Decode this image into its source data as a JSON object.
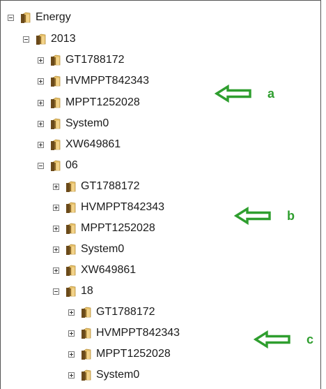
{
  "tree": {
    "root": {
      "label": "Energy",
      "state": "expanded"
    },
    "year": {
      "label": "2013",
      "state": "expanded"
    },
    "year_children": [
      {
        "label": "GT1788172",
        "state": "collapsed"
      },
      {
        "label": "HVMPPT842343",
        "state": "collapsed"
      },
      {
        "label": "MPPT1252028",
        "state": "collapsed"
      },
      {
        "label": "System0",
        "state": "collapsed"
      },
      {
        "label": "XW649861",
        "state": "collapsed"
      }
    ],
    "month": {
      "label": "06",
      "state": "expanded"
    },
    "month_children": [
      {
        "label": "GT1788172",
        "state": "collapsed"
      },
      {
        "label": "HVMPPT842343",
        "state": "collapsed"
      },
      {
        "label": "MPPT1252028",
        "state": "collapsed"
      },
      {
        "label": "System0",
        "state": "collapsed"
      },
      {
        "label": "XW649861",
        "state": "collapsed"
      }
    ],
    "day": {
      "label": "18",
      "state": "expanded"
    },
    "day_children": [
      {
        "label": "GT1788172",
        "state": "collapsed"
      },
      {
        "label": "HVMPPT842343",
        "state": "collapsed"
      },
      {
        "label": "MPPT1252028",
        "state": "collapsed"
      },
      {
        "label": "System0",
        "state": "collapsed"
      }
    ]
  },
  "annotations": [
    {
      "label": "a"
    },
    {
      "label": "b"
    },
    {
      "label": "c"
    }
  ],
  "colors": {
    "annotation_green": "#2e9e2e",
    "folder_light": "#e3c06a",
    "folder_dark": "#7a5a22",
    "text": "#1a1a1a"
  },
  "icons": {
    "expand": "plus-box",
    "collapse": "minus-box",
    "folder": "folder-icon",
    "arrow": "left-arrow-outline"
  }
}
